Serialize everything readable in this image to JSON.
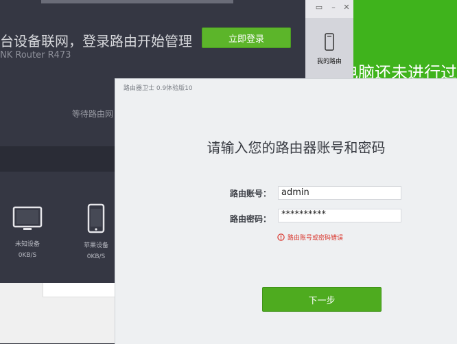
{
  "green_window": {
    "text": "电脑还未进行过"
  },
  "main_app": {
    "headline": "台设备联网，登录路由开始管理",
    "model": "NK Router R473",
    "login_button": "立即登录",
    "waiting_text": "等待路由网",
    "devices": [
      {
        "label": "未知设备",
        "speed": "0KB/S",
        "icon": "monitor-icon"
      },
      {
        "label": "苹果设备",
        "speed": "0KB/S",
        "icon": "phone-icon"
      }
    ]
  },
  "side_panel": {
    "label": "我的路由"
  },
  "dialog": {
    "title": "路由器卫士 0.9体验版10",
    "heading": "请输入您的路由器账号和密码",
    "account_label": "路由账号：",
    "account_value": "admin",
    "password_label": "路由密码：",
    "password_value": "**********",
    "error_text": "路由账号或密码错误",
    "next_button": "下一步"
  },
  "colors": {
    "green": "#3fb31c",
    "dark": "#353743",
    "button_green": "#4eab1f",
    "error": "#d9342b"
  }
}
